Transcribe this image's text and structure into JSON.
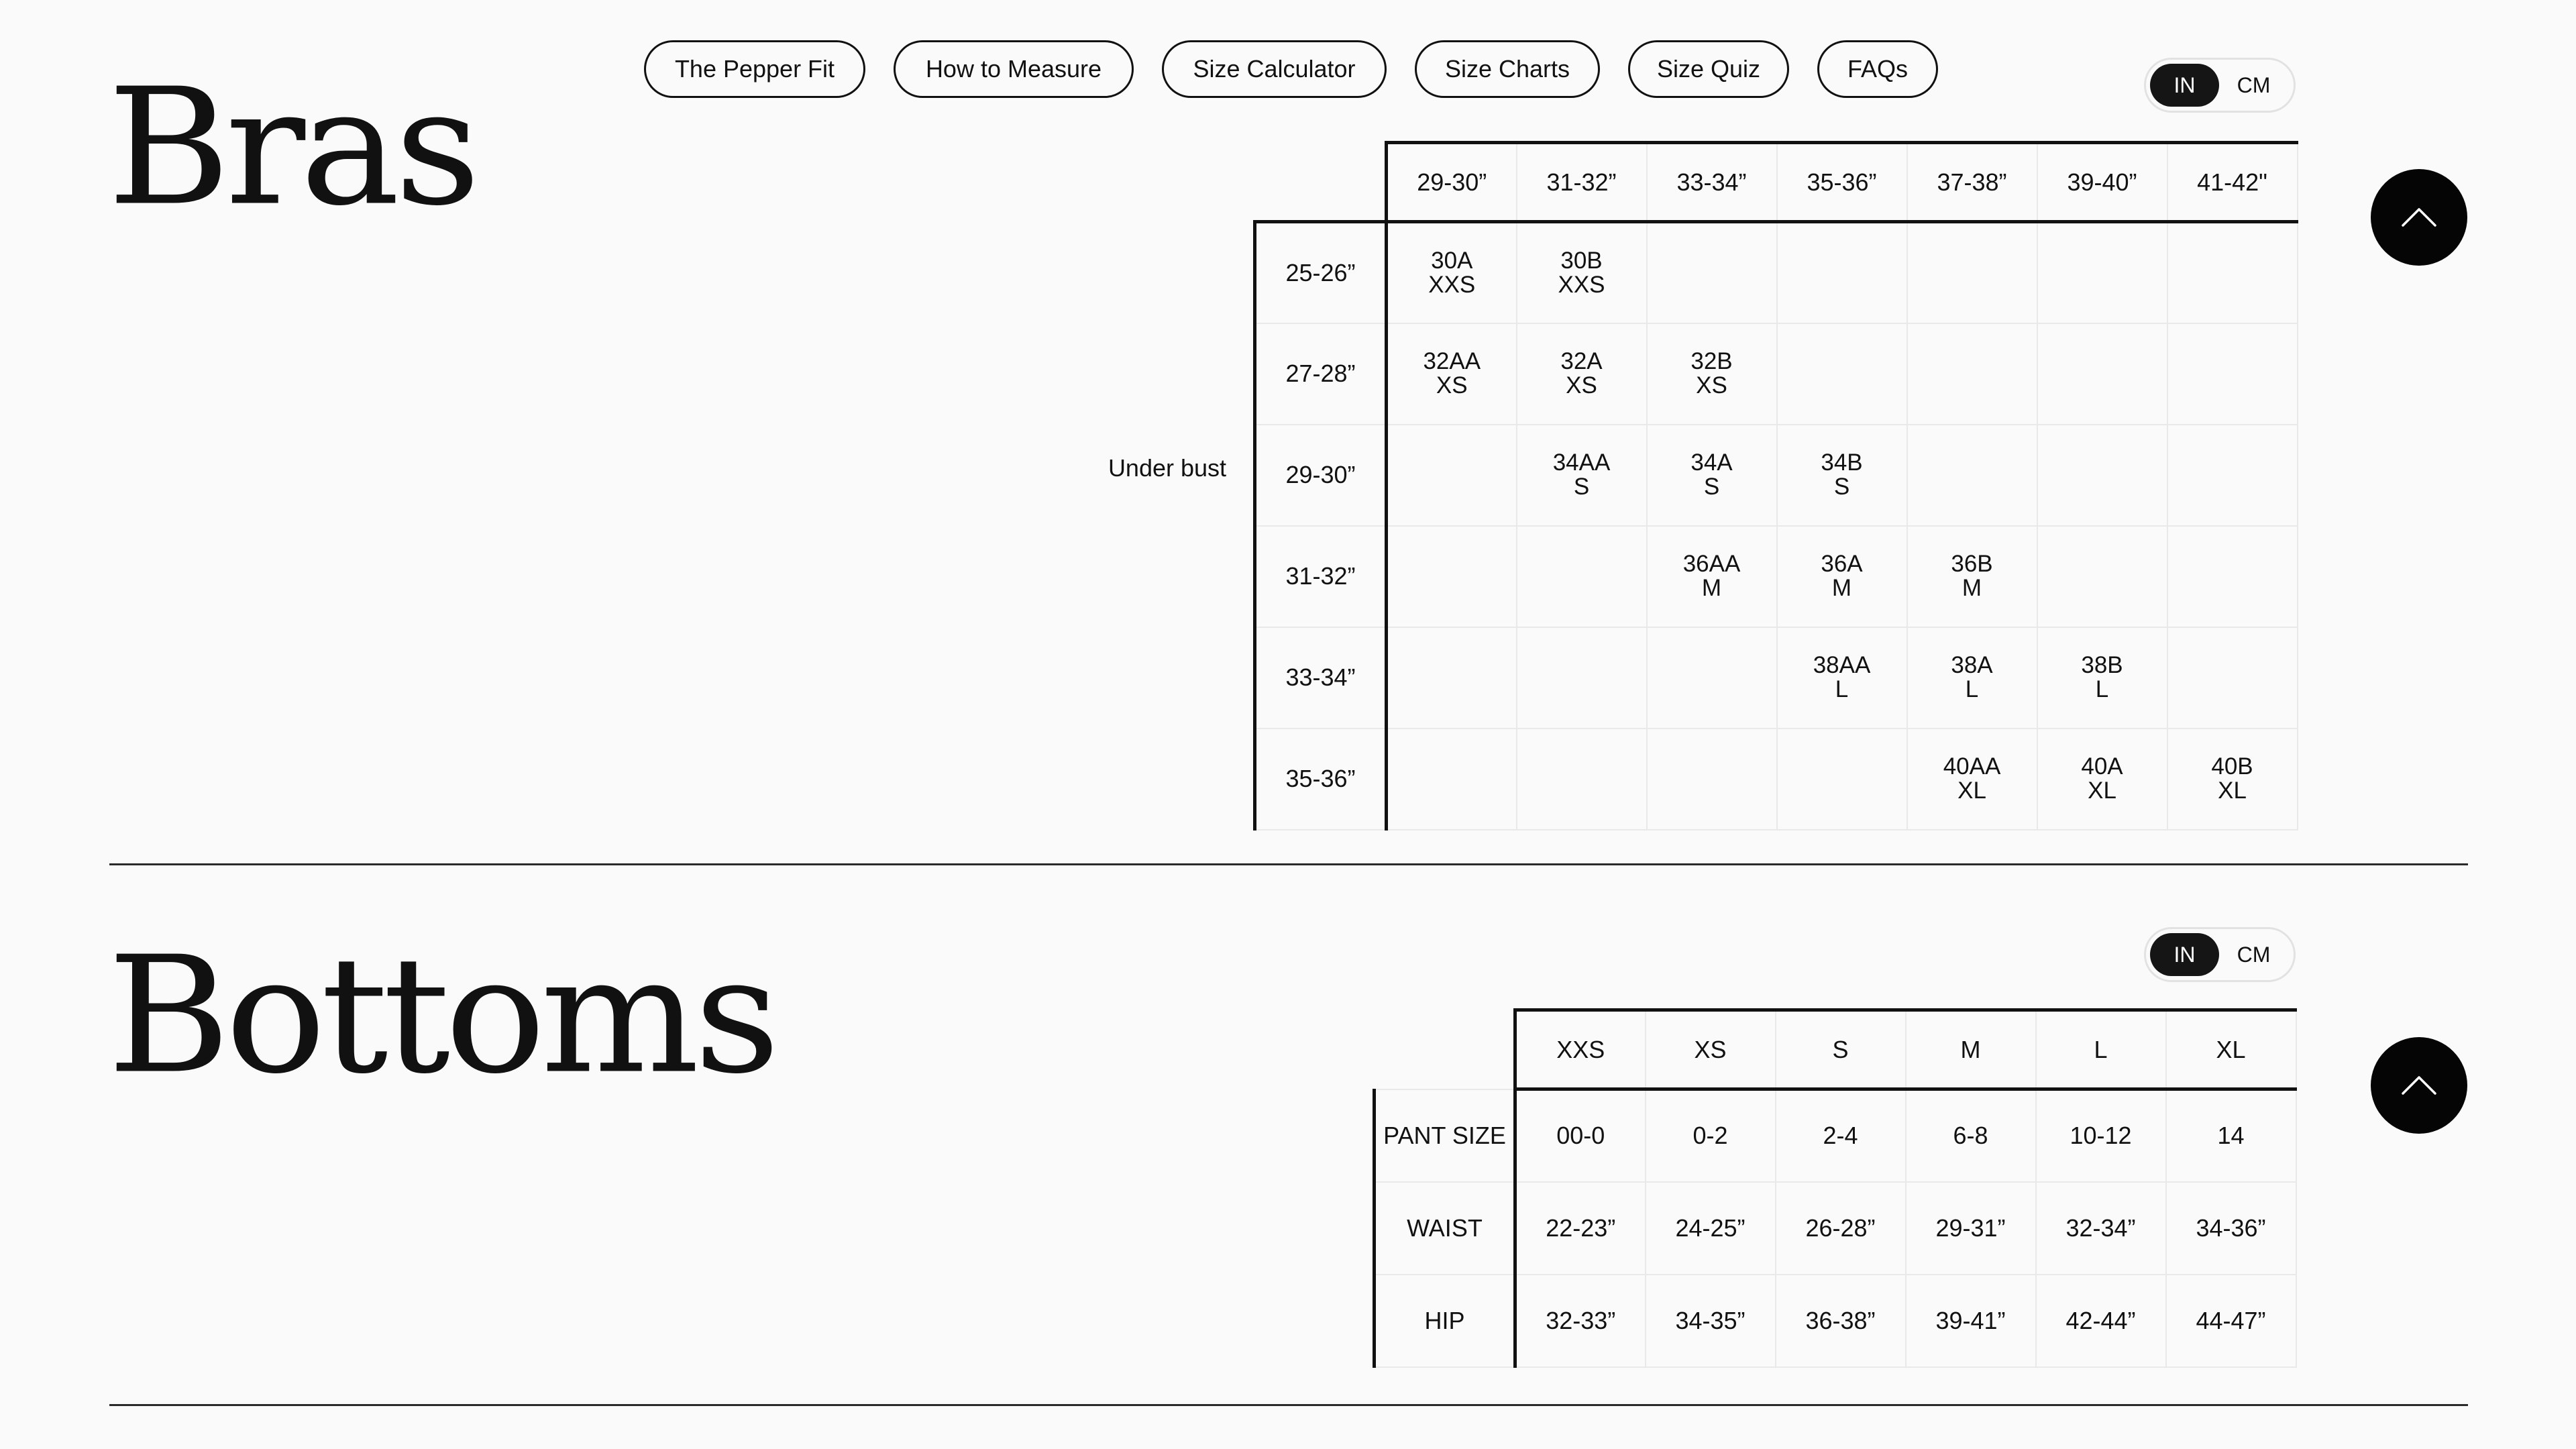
{
  "nav": {
    "items": [
      {
        "label": "The Pepper Fit"
      },
      {
        "label": "How to Measure"
      },
      {
        "label": "Size Calculator"
      },
      {
        "label": "Size Charts"
      },
      {
        "label": "Size Quiz"
      },
      {
        "label": "FAQs"
      }
    ]
  },
  "bras": {
    "title": "Bras",
    "units": {
      "in": "IN",
      "cm": "CM",
      "selected": "IN"
    },
    "row_axis_label": "Under bust",
    "columns": [
      "29-30”",
      "31-32”",
      "33-34”",
      "35-36”",
      "37-38”",
      "39-40”",
      "41-42\""
    ],
    "rows": [
      {
        "label": "25-26”",
        "cells": [
          {
            "size": "30A",
            "band": "XXS"
          },
          {
            "size": "30B",
            "band": "XXS"
          },
          null,
          null,
          null,
          null,
          null
        ]
      },
      {
        "label": "27-28”",
        "cells": [
          {
            "size": "32AA",
            "band": "XS"
          },
          {
            "size": "32A",
            "band": "XS"
          },
          {
            "size": "32B",
            "band": "XS"
          },
          null,
          null,
          null,
          null
        ]
      },
      {
        "label": "29-30”",
        "cells": [
          null,
          {
            "size": "34AA",
            "band": "S"
          },
          {
            "size": "34A",
            "band": "S"
          },
          {
            "size": "34B",
            "band": "S"
          },
          null,
          null,
          null
        ]
      },
      {
        "label": "31-32”",
        "cells": [
          null,
          null,
          {
            "size": "36AA",
            "band": "M"
          },
          {
            "size": "36A",
            "band": "M"
          },
          {
            "size": "36B",
            "band": "M"
          },
          null,
          null
        ]
      },
      {
        "label": "33-34”",
        "cells": [
          null,
          null,
          null,
          {
            "size": "38AA",
            "band": "L"
          },
          {
            "size": "38A",
            "band": "L"
          },
          {
            "size": "38B",
            "band": "L"
          },
          null
        ]
      },
      {
        "label": "35-36”",
        "cells": [
          null,
          null,
          null,
          null,
          {
            "size": "40AA",
            "band": "XL"
          },
          {
            "size": "40A",
            "band": "XL"
          },
          {
            "size": "40B",
            "band": "XL"
          }
        ]
      }
    ]
  },
  "bottoms": {
    "title": "Bottoms",
    "units": {
      "in": "IN",
      "cm": "CM",
      "selected": "IN"
    },
    "columns": [
      "XXS",
      "XS",
      "S",
      "M",
      "L",
      "XL"
    ],
    "rows": [
      {
        "label": "PANT SIZE",
        "cells": [
          "00-0",
          "0-2",
          "2-4",
          "6-8",
          "10-12",
          "14"
        ]
      },
      {
        "label": "WAIST",
        "cells": [
          "22-23”",
          "24-25”",
          "26-28”",
          "29-31”",
          "32-34”",
          "34-36”"
        ]
      },
      {
        "label": "HIP",
        "cells": [
          "32-33”",
          "34-35”",
          "36-38”",
          "39-41”",
          "42-44”",
          "44-47”"
        ]
      }
    ]
  },
  "icons": {
    "scroll_top": "chevron-up-icon"
  },
  "colors": {
    "background": "#fafafa",
    "text": "#111111",
    "toggle_active": "#151515",
    "scroll_button": "#050505",
    "grid_line": "#e9e9e9"
  }
}
